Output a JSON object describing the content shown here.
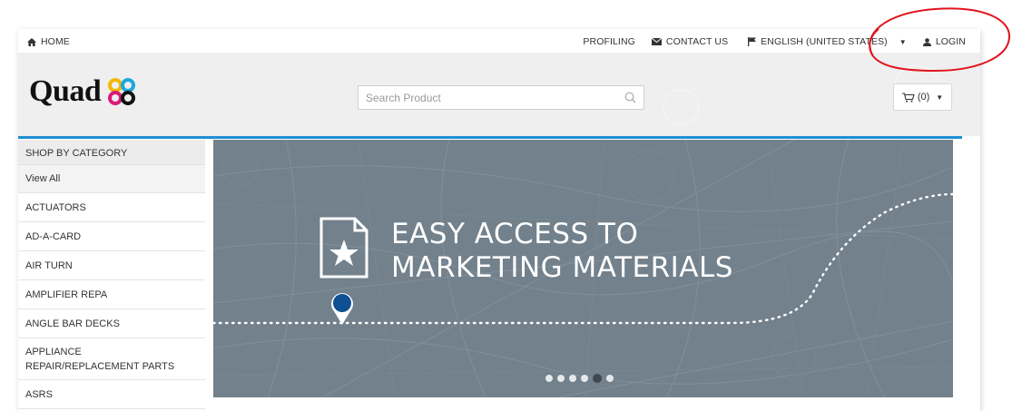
{
  "topbar": {
    "home_label": "HOME",
    "profiling_label": "PROFILING",
    "contact_label": "CONTACT US",
    "language_label": "ENGLISH (UNITED STATES)",
    "login_label": "LOGIN"
  },
  "header": {
    "logo_text": "Quad",
    "search_placeholder": "Search Product",
    "cart_label": "(0)"
  },
  "sidebar": {
    "heading": "SHOP BY CATEGORY",
    "items": [
      {
        "label": "View All"
      },
      {
        "label": "ACTUATORS"
      },
      {
        "label": "AD-A-CARD"
      },
      {
        "label": "AIR TURN"
      },
      {
        "label": "AMPLIFIER REPA"
      },
      {
        "label": "ANGLE BAR DECKS"
      },
      {
        "label": "APPLIANCE REPAIR/REPLACEMENT PARTS"
      },
      {
        "label": "ASRS"
      }
    ]
  },
  "banner": {
    "line1": "EASY ACCESS TO",
    "line2": "MARKETING MATERIALS",
    "slide_count": 6,
    "active_slide": 5
  },
  "colors": {
    "accent_blue": "#1f8fd4",
    "banner_bg": "#72818c",
    "pin_blue": "#0f4f93",
    "annotation_red": "#e0141b",
    "logo_yellow": "#f2b705",
    "logo_cyan": "#1ea5dc",
    "logo_magenta": "#d9197a",
    "logo_black": "#111111"
  },
  "icons": {
    "home": "home-icon",
    "contact": "envelope-icon",
    "language": "flag-icon",
    "login": "user-icon",
    "search": "search-icon",
    "cart": "cart-icon",
    "banner": "star-document-icon",
    "pin": "map-pin-icon"
  }
}
